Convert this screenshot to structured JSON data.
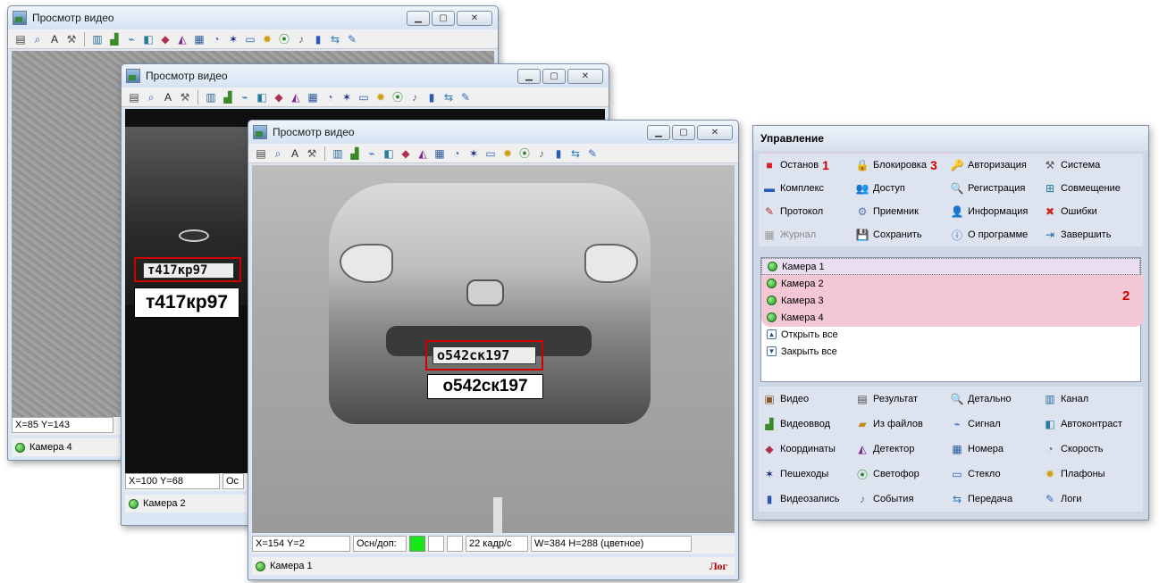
{
  "windows": [
    {
      "title": "Просмотр видео",
      "coords": "X=85 Y=143",
      "camera": "Камера 4"
    },
    {
      "title": "Просмотр видео",
      "coords": "X=100 Y=68",
      "status_cut": "Ос",
      "camera": "Камера 2",
      "plate_text": "т417кр97",
      "plate_region": "97"
    },
    {
      "title": "Просмотр видео",
      "coords": "X=154 Y=2",
      "main_label": "Осн/доп:",
      "fps": "22 кадр/с",
      "resolution": "W=384 H=288 (цветное)",
      "camera": "Камера 1",
      "log_link": "Лог",
      "plate_text": "о542ск197",
      "plate_region": "197"
    }
  ],
  "toolbar_icons": [
    "result-icon",
    "search-icon",
    "font-icon",
    "tools-icon",
    "channel-icon",
    "videoinput-icon",
    "signal-icon",
    "autocontrast-icon",
    "coordinates-icon",
    "detector-icon",
    "numbers-icon",
    "speed-icon",
    "pedestrian-icon",
    "glass-icon",
    "lamp-icon",
    "traffic-light-icon",
    "events-icon",
    "videorecord-icon",
    "transfer-icon",
    "logs-icon"
  ],
  "panel": {
    "title": "Управление",
    "top": [
      {
        "label": "Останов",
        "icon": "stop-icon",
        "glyph": "■",
        "color": "#d42020",
        "badge": "1"
      },
      {
        "label": "Блокировка",
        "icon": "lock-icon",
        "glyph": "🔒",
        "color": "#c88a1a",
        "badge": "3"
      },
      {
        "label": "Авторизация",
        "icon": "key-icon",
        "glyph": "🔑",
        "color": "#c9a12a"
      },
      {
        "label": "Система",
        "icon": "tools-icon",
        "glyph": "⚒",
        "color": "#555"
      },
      {
        "label": "Комплекс",
        "icon": "computer-icon",
        "glyph": "▬",
        "color": "#2a5ab8"
      },
      {
        "label": "Доступ",
        "icon": "users-icon",
        "glyph": "👥",
        "color": "#2a6ab8"
      },
      {
        "label": "Регистрация",
        "icon": "register-icon",
        "glyph": "🔍",
        "color": "#3a6ab0"
      },
      {
        "label": "Совмещение",
        "icon": "merge-icon",
        "glyph": "⊞",
        "color": "#1a7a9a"
      },
      {
        "label": "Протокол",
        "icon": "protocol-icon",
        "glyph": "✎",
        "color": "#b03030"
      },
      {
        "label": "Приемник",
        "icon": "receiver-icon",
        "glyph": "⚙",
        "color": "#5a7ab0"
      },
      {
        "label": "Информация",
        "icon": "info-person-icon",
        "glyph": "👤",
        "color": "#c07a10"
      },
      {
        "label": "Ошибки",
        "icon": "error-icon",
        "glyph": "✖",
        "color": "#d02020"
      },
      {
        "label": "Журнал",
        "icon": "journal-icon",
        "glyph": "▦",
        "color": "#9a9a9a",
        "dim": true
      },
      {
        "label": "Сохранить",
        "icon": "save-icon",
        "glyph": "💾",
        "color": "#2a5ab8"
      },
      {
        "label": "О программе",
        "icon": "about-icon",
        "glyph": "ⓘ",
        "color": "#2a6ab8"
      },
      {
        "label": "Завершить",
        "icon": "exit-icon",
        "glyph": "⇥",
        "color": "#1a6aa0"
      }
    ],
    "cameras": [
      "Камера 1",
      "Камера 2",
      "Камера 3",
      "Камера 4"
    ],
    "open_all": "Открыть все",
    "close_all": "Закрыть все",
    "camera_badge": "2",
    "bottom": [
      {
        "label": "Видео",
        "icon": "video-icon",
        "glyph": "▣",
        "color": "#8a5a2a"
      },
      {
        "label": "Результат",
        "icon": "result-icon",
        "glyph": "▤",
        "color": "#4a4a4a"
      },
      {
        "label": "Детально",
        "icon": "detail-icon",
        "glyph": "🔍",
        "color": "#3a6ab0"
      },
      {
        "label": "Канал",
        "icon": "channel-icon",
        "glyph": "▥",
        "color": "#2a6a9a"
      },
      {
        "label": "Видеоввод",
        "icon": "videoinput-icon",
        "glyph": "▟",
        "color": "#3a8a2a"
      },
      {
        "label": "Из файлов",
        "icon": "files-icon",
        "glyph": "▰",
        "color": "#c08a20"
      },
      {
        "label": "Сигнал",
        "icon": "signal-icon",
        "glyph": "⌁",
        "color": "#2a6ab8"
      },
      {
        "label": "Автоконтраст",
        "icon": "autocontrast-icon",
        "glyph": "◧",
        "color": "#2a7aa0"
      },
      {
        "label": "Координаты",
        "icon": "coordinates-icon",
        "glyph": "◆",
        "color": "#b03050"
      },
      {
        "label": "Детектор",
        "icon": "detector-icon",
        "glyph": "◭",
        "color": "#7a2a8a"
      },
      {
        "label": "Номера",
        "icon": "numbers-icon",
        "glyph": "▦",
        "color": "#2a5a9a"
      },
      {
        "label": "Скорость",
        "icon": "speed-icon",
        "glyph": "◔",
        "color": "#4a6a9a"
      },
      {
        "label": "Пешеходы",
        "icon": "pedestrian-icon",
        "glyph": "✶",
        "color": "#1a2a8a"
      },
      {
        "label": "Светофор",
        "icon": "traffic-light-icon",
        "glyph": "⦿",
        "color": "#2a8a2a"
      },
      {
        "label": "Стекло",
        "icon": "glass-icon",
        "glyph": "▭",
        "color": "#2a5ab8"
      },
      {
        "label": "Плафоны",
        "icon": "lamp-icon",
        "glyph": "✹",
        "color": "#d0a010"
      },
      {
        "label": "Видеозапись",
        "icon": "videorecord-icon",
        "glyph": "▮",
        "color": "#2a5ab8"
      },
      {
        "label": "События",
        "icon": "events-icon",
        "glyph": "♪",
        "color": "#6a6a6a"
      },
      {
        "label": "Передача",
        "icon": "transfer-icon",
        "glyph": "⇆",
        "color": "#2a7ab8"
      },
      {
        "label": "Логи",
        "icon": "logs-icon",
        "glyph": "✎",
        "color": "#3a6ab8"
      }
    ]
  }
}
